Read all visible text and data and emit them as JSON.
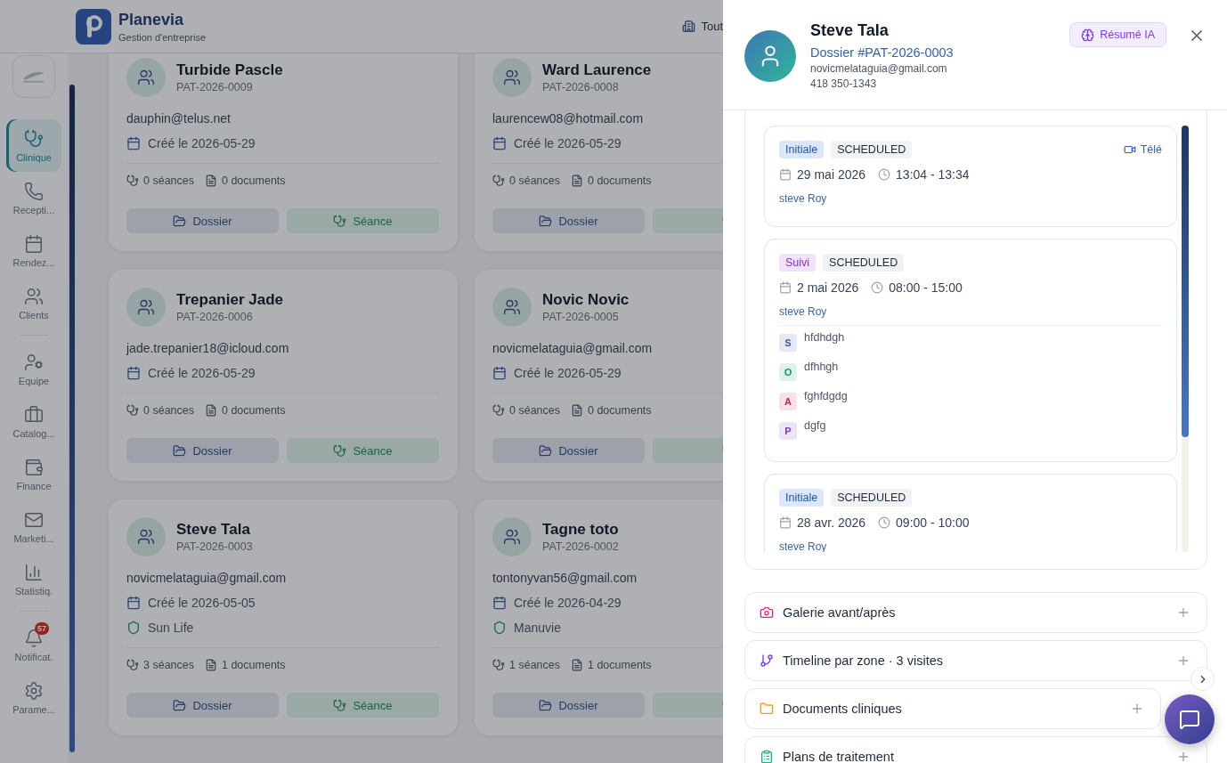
{
  "app": {
    "name": "Planevia",
    "subtitle": "Gestion d'entreprise",
    "header_filter": "Tout"
  },
  "sidebar": {
    "sections": [
      {
        "items": [
          {
            "label": "Clinique",
            "selected": true
          },
          {
            "label": "Recepti...",
            "selected": false
          },
          {
            "label": "Rendez...",
            "selected": false
          },
          {
            "label": "Clients",
            "selected": false
          }
        ]
      },
      {
        "items": [
          {
            "label": "Equipe",
            "selected": false
          },
          {
            "label": "Catalog...",
            "selected": false
          },
          {
            "label": "Finance",
            "selected": false
          },
          {
            "label": "Marketi...",
            "selected": false
          },
          {
            "label": "Statistiq.",
            "selected": false
          }
        ]
      },
      {
        "items": [
          {
            "label": "Notificat.",
            "selected": false,
            "badge": "57"
          },
          {
            "label": "Parame...",
            "selected": false
          }
        ]
      }
    ]
  },
  "patients": [
    {
      "name": "Turbide Pascle",
      "id": "PAT-2026-0009",
      "email": "dauphin@telus.net",
      "created": "Créé le 2026-05-29",
      "sessions": "0 séances",
      "documents": "0 documents",
      "folder_button": "Dossier",
      "session_button": "Séance"
    },
    {
      "name": "Ward Laurence",
      "id": "PAT-2026-0008",
      "email": "laurencew08@hotmail.com",
      "created": "Créé le 2026-05-29",
      "sessions": "0 séances",
      "documents": "0 documents",
      "folder_button": "Dossier"
    },
    {
      "name": "Trepanier Jade",
      "id": "PAT-2026-0006",
      "email": "jade.trepanier18@icloud.com",
      "created": "Créé le 2026-05-29",
      "sessions": "0 séances",
      "documents": "0 documents",
      "folder_button": "Dossier",
      "session_button": "Séance"
    },
    {
      "name": "Novic Novic",
      "id": "PAT-2026-0005",
      "email": "novicmelataguia@gmail.com",
      "created": "Créé le 2026-05-29",
      "sessions": "0 séances",
      "documents": "0 documents",
      "folder_button": "Dossier"
    },
    {
      "name": "Steve Tala",
      "id": "PAT-2026-0003",
      "email": "novicmelataguia@gmail.com",
      "created": "Créé le 2026-05-05",
      "insurer": "Sun Life",
      "sessions": "3 séances",
      "documents": "1 documents",
      "folder_button": "Dossier",
      "session_button": "Séance"
    },
    {
      "name": "Tagne toto",
      "id": "PAT-2026-0002",
      "email": "tontonyvan56@gmail.com",
      "created": "Créé le 2026-04-29",
      "insurer": "Manuvie",
      "sessions": "1 séances",
      "documents": "1 documents",
      "folder_button": "Dossier"
    }
  ],
  "panel": {
    "name": "Steve Tala",
    "file": "Dossier #PAT-2026-0003",
    "email": "novicmelataguia@gmail.com",
    "phone": "418 350-1343",
    "summary_button": "Résumé IA",
    "sessions": [
      {
        "type": "Initiale",
        "kind": "initial",
        "status": "SCHEDULED",
        "mode": "Télé",
        "date": "29 mai 2026",
        "time": "13:04 - 13:34",
        "practitioner": "steve Roy"
      },
      {
        "type": "Suivi",
        "kind": "followup",
        "status": "SCHEDULED",
        "date": "2 mai 2026",
        "time": "08:00 - 15:00",
        "practitioner": "steve Roy",
        "notes": [
          {
            "letter": "S",
            "text": "hfdhdgh",
            "color": "#3b5ba8"
          },
          {
            "letter": "O",
            "text": "dfhhgh",
            "color": "#15935f"
          },
          {
            "letter": "A",
            "text": "fghfdgdg",
            "color": "#c0264a"
          },
          {
            "letter": "P",
            "text": "dgfg",
            "color": "#7a3fc0"
          }
        ]
      },
      {
        "type": "Initiale",
        "kind": "initial",
        "status": "SCHEDULED",
        "date": "28 avr. 2026",
        "time": "09:00 - 10:00",
        "practitioner": "steve Roy"
      }
    ],
    "sections": [
      {
        "title": "Galerie avant/après",
        "expanded": false
      },
      {
        "title": "Timeline par zone · 3 visites",
        "expanded": false
      },
      {
        "title": "Documents cliniques",
        "expanded": false
      },
      {
        "title": "Plans de traitement",
        "expanded": false
      }
    ]
  }
}
